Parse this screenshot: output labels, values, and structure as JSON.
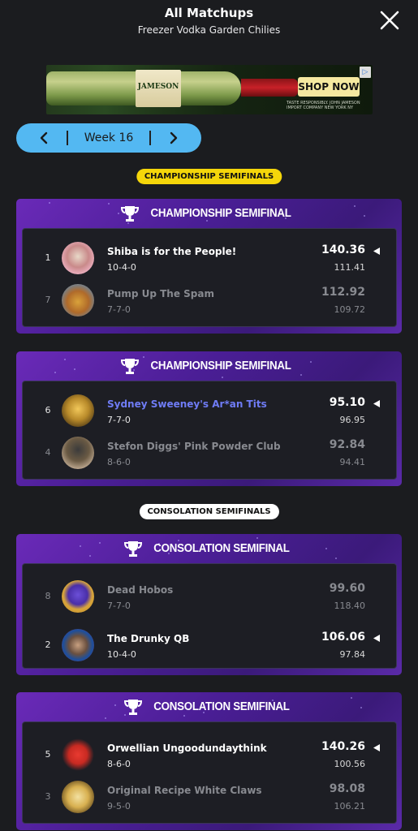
{
  "header": {
    "title": "All Matchups",
    "subtitle": "Freezer Vodka Garden Chilies"
  },
  "ad": {
    "brand": "JAMESON",
    "cta": "SHOP NOW",
    "disclaimer": "TASTE RESPONSIBLY. JOHN JAMESON IMPORT COMPANY NEW YORK NY"
  },
  "week_nav": {
    "label": "Week 16"
  },
  "sections": {
    "championship_label": "CHAMPIONSHIP SEMIFINALS",
    "consolation_label": "CONSOLATION SEMIFINALS"
  },
  "matchups": [
    {
      "title": "CHAMPIONSHIP SEMIFINAL",
      "teams": [
        {
          "seed": "1",
          "name": "Shiba is for the People!",
          "record": "10-4-0",
          "score": "140.36",
          "proj": "111.41",
          "winner": true
        },
        {
          "seed": "7",
          "name": "Pump Up The Spam",
          "record": "7-7-0",
          "score": "112.92",
          "proj": "109.72",
          "winner": false
        }
      ]
    },
    {
      "title": "CHAMPIONSHIP SEMIFINAL",
      "teams": [
        {
          "seed": "6",
          "name": "Sydney Sweeney's Ar*an Tits",
          "record": "7-7-0",
          "score": "95.10",
          "proj": "96.95",
          "winner": true
        },
        {
          "seed": "4",
          "name": "Stefon Diggs' Pink Powder Club",
          "record": "8-6-0",
          "score": "92.84",
          "proj": "94.41",
          "winner": false
        }
      ]
    },
    {
      "title": "CONSOLATION SEMIFINAL",
      "teams": [
        {
          "seed": "8",
          "name": "Dead Hobos",
          "record": "7-7-0",
          "score": "99.60",
          "proj": "118.40",
          "winner": false
        },
        {
          "seed": "2",
          "name": "The Drunky QB",
          "record": "10-4-0",
          "score": "106.06",
          "proj": "97.84",
          "winner": true
        }
      ]
    },
    {
      "title": "CONSOLATION SEMIFINAL",
      "teams": [
        {
          "seed": "5",
          "name": "Orwellian Ungoodundaythink",
          "record": "8-6-0",
          "score": "140.26",
          "proj": "100.56",
          "winner": true
        },
        {
          "seed": "3",
          "name": "Original Recipe White Claws",
          "record": "9-5-0",
          "score": "98.08",
          "proj": "106.21",
          "winner": false
        }
      ]
    }
  ],
  "colors": {
    "background": "#1b1c1f",
    "week_nav": "#53b8f2",
    "championship_pill": "#f5d60a",
    "card_purple": "#4a1e95",
    "highlight_name": "#6f7cf6"
  }
}
